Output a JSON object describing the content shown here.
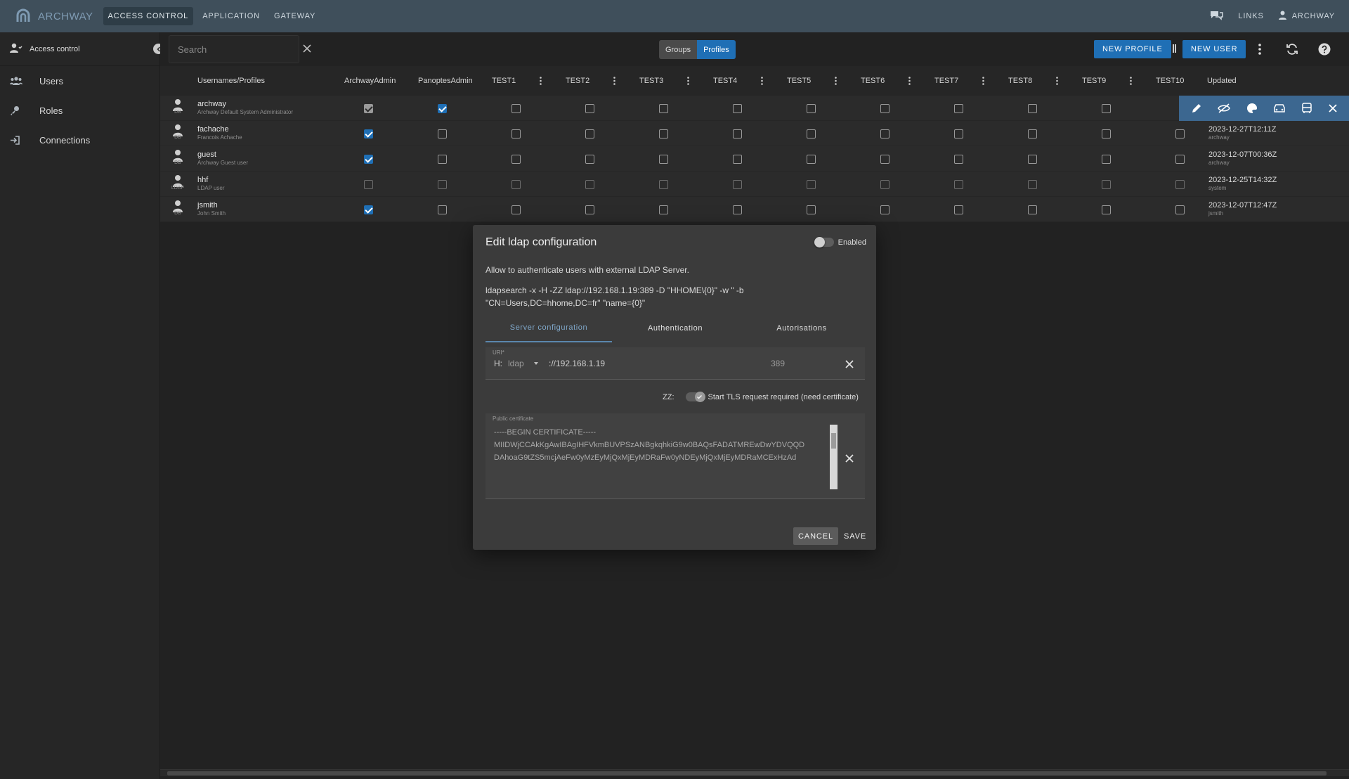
{
  "app": {
    "brand": "ARCHWAY"
  },
  "topnav": [
    "ACCESS CONTROL",
    "APPLICATION",
    "GATEWAY"
  ],
  "topright": {
    "links": "LINKS",
    "user": "ARCHWAY"
  },
  "sidebar": {
    "header": "Access control",
    "items": [
      {
        "label": "Users",
        "icon": "users-icon"
      },
      {
        "label": "Roles",
        "icon": "key-icon"
      },
      {
        "label": "Connections",
        "icon": "login-icon"
      }
    ]
  },
  "toolbar": {
    "search_placeholder": "Search",
    "toggle": [
      "Groups",
      "Profiles"
    ],
    "toggle_selected": "Profiles",
    "new_profile": "NEW PROFILE",
    "new_user": "NEW USER"
  },
  "table": {
    "headers": [
      "Usernames/Profiles",
      "ArchwayAdmin",
      "PanoptesAdmin",
      "TEST1",
      "TEST2",
      "TEST3",
      "TEST4",
      "TEST5",
      "TEST6",
      "TEST7",
      "TEST8",
      "TEST9",
      "TEST10",
      "Updated"
    ],
    "rows": [
      {
        "name": "archway",
        "desc": "Archway Default System Administrator",
        "source": "DB",
        "updated": "",
        "updated_by": "",
        "checks": [
          "grey",
          "on",
          "off",
          "off",
          "off",
          "off",
          "off",
          "off",
          "off",
          "off",
          "off",
          "off"
        ]
      },
      {
        "name": "fachache",
        "desc": "Francois Achache",
        "source": "DB",
        "updated": "2023-12-27T12:11Z",
        "updated_by": "archway",
        "checks": [
          "on",
          "off",
          "off",
          "off",
          "off",
          "off",
          "off",
          "off",
          "off",
          "off",
          "off",
          "off"
        ]
      },
      {
        "name": "guest",
        "desc": "Archway Guest user",
        "source": "DB",
        "updated": "2023-12-07T00:36Z",
        "updated_by": "archway",
        "checks": [
          "on",
          "off",
          "off",
          "off",
          "off",
          "off",
          "off",
          "off",
          "off",
          "off",
          "off",
          "off"
        ]
      },
      {
        "name": "hhf",
        "desc": "LDAP user",
        "source": "LDAP",
        "updated": "2023-12-25T14:32Z",
        "updated_by": "system",
        "checks": [
          "dim",
          "dim",
          "dim",
          "dim",
          "dim",
          "dim",
          "dim",
          "dim",
          "dim",
          "dim",
          "dim",
          "dim"
        ]
      },
      {
        "name": "jsmith",
        "desc": "John Smith",
        "source": "DB",
        "updated": "2023-12-07T12:47Z",
        "updated_by": "jsmith",
        "checks": [
          "on",
          "off",
          "off",
          "off",
          "off",
          "off",
          "off",
          "off",
          "off",
          "off",
          "off",
          "off"
        ]
      }
    ]
  },
  "dialog": {
    "title": "Edit ldap configuration",
    "enabled_label": "Enabled",
    "enabled": false,
    "description": "Allow to authenticate users with external LDAP Server.",
    "command_line1": "ldapsearch -x -H -ZZ ldap://192.168.1.19:389 -D \"HHOME\\{0}\" -w \" -b",
    "command_line2": "\"CN=Users,DC=hhome,DC=fr\" \"name={0}\"",
    "tabs": [
      "Server configuration",
      "Authentication",
      "Autorisations"
    ],
    "active_tab": "Server configuration",
    "uri_label": "URI*",
    "uri_prefix": "H:",
    "uri_scheme": "ldap",
    "uri_host": "://192.168.1.19",
    "uri_port": "389",
    "tls_prefix": "ZZ:",
    "tls_label": "Start TLS request required (need certificate)",
    "tls_enabled": true,
    "cert_label": "Public certificate",
    "cert_lines": [
      "-----BEGIN CERTIFICATE-----",
      "MIIDWjCCAkKgAwIBAgIHFVkmBUVPSzANBgkqhkiG9w0BAQsFADATMREwDwYDVQQD",
      "DAhoaG9tZS5mcjAeFw0yMzEyMjQxMjEyMDRaFw0yNDEyMjQxMjEyMDRaMCExHzAd"
    ],
    "cancel": "CANCEL",
    "save": "SAVE"
  },
  "colors": {
    "accent": "#1f6fb5",
    "topbar": "#3f4f5b",
    "selected_row": "#3c6790"
  }
}
